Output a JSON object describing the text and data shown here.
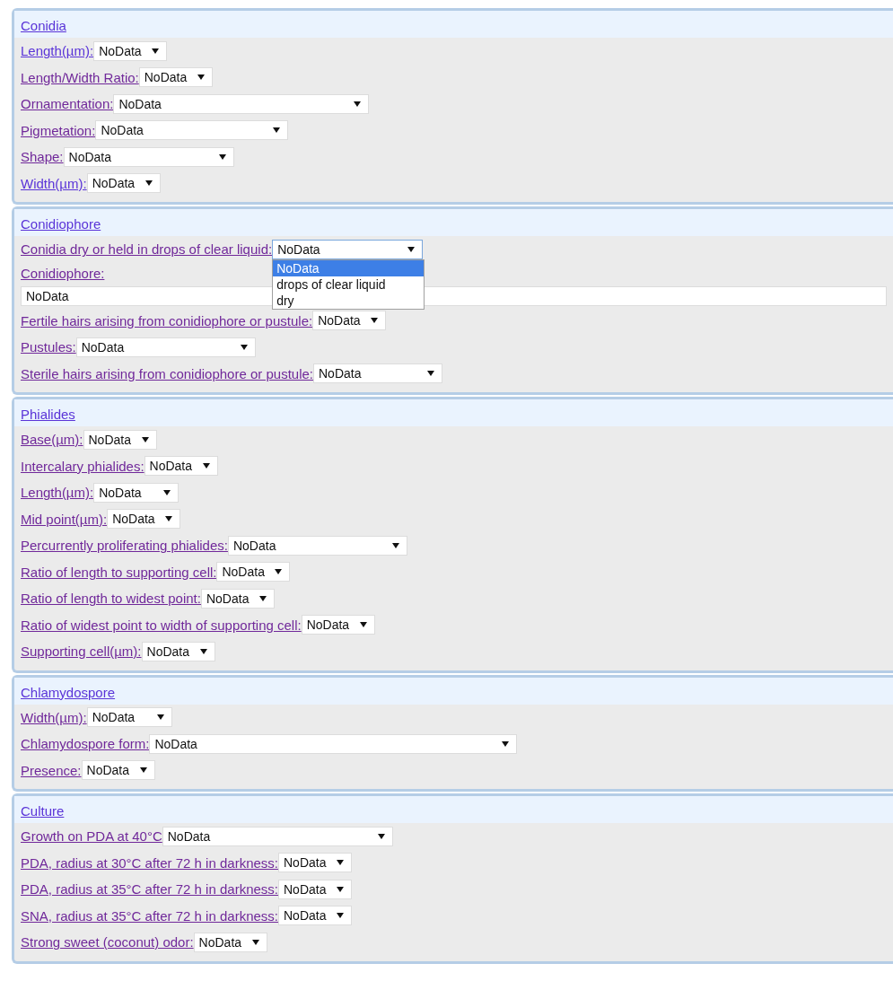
{
  "sections": [
    {
      "title": "Conidia",
      "fields": [
        {
          "kind": "select",
          "label": "Length(µm):",
          "visited": false,
          "value": "NoData",
          "open": false
        },
        {
          "kind": "select",
          "label": "Length/Width Ratio:",
          "visited": true,
          "value": "NoData",
          "open": false
        },
        {
          "kind": "select",
          "label": "Ornamentation:",
          "visited": true,
          "value": "NoData",
          "open": false
        },
        {
          "kind": "select",
          "label": "Pigmetation:",
          "visited": true,
          "value": "NoData",
          "open": false
        },
        {
          "kind": "select",
          "label": "Shape:",
          "visited": true,
          "value": "NoData",
          "open": false
        },
        {
          "kind": "select",
          "label": "Width(µm):",
          "visited": false,
          "value": "NoData",
          "open": false
        }
      ]
    },
    {
      "title": "Conidiophore",
      "fields": [
        {
          "kind": "select",
          "label": "Conidia dry or held in drops of clear liquid:",
          "visited": true,
          "value": "NoData",
          "open": true,
          "options": [
            {
              "label": "NoData",
              "selected": true
            },
            {
              "label": "drops of clear liquid",
              "selected": false
            },
            {
              "label": "dry",
              "selected": false
            }
          ]
        },
        {
          "kind": "text",
          "label": "Conidiophore:",
          "visited": true,
          "value": "NoData"
        },
        {
          "kind": "select",
          "label": "Fertile hairs arising from conidiophore or pustule:",
          "visited": true,
          "value": "NoData",
          "open": false
        },
        {
          "kind": "select",
          "label": "Pustules:",
          "visited": true,
          "value": "NoData",
          "open": false
        },
        {
          "kind": "select",
          "label": "Sterile hairs arising from conidiophore or pustule:",
          "visited": true,
          "value": "NoData",
          "open": false
        }
      ]
    },
    {
      "title": "Phialides",
      "fields": [
        {
          "kind": "select",
          "label": "Base(µm):",
          "visited": true,
          "value": "NoData",
          "open": false
        },
        {
          "kind": "select",
          "label": "Intercalary phialides:",
          "visited": true,
          "value": "NoData",
          "open": false
        },
        {
          "kind": "select",
          "label": "Length(µm):",
          "visited": true,
          "value": "NoData",
          "open": false
        },
        {
          "kind": "select",
          "label": "Mid point(µm):",
          "visited": true,
          "value": "NoData",
          "open": false
        },
        {
          "kind": "select",
          "label": "Percurrently proliferating phialides:",
          "visited": true,
          "value": "NoData",
          "open": false
        },
        {
          "kind": "select",
          "label": "Ratio of length to supporting cell:",
          "visited": true,
          "value": "NoData",
          "open": false
        },
        {
          "kind": "select",
          "label": "Ratio of length to widest point:",
          "visited": true,
          "value": "NoData",
          "open": false
        },
        {
          "kind": "select",
          "label": "Ratio of widest point to width of supporting cell:",
          "visited": true,
          "value": "NoData",
          "open": false
        },
        {
          "kind": "select",
          "label": "Supporting cell(µm):",
          "visited": true,
          "value": "NoData",
          "open": false
        }
      ]
    },
    {
      "title": "Chlamydospore",
      "fields": [
        {
          "kind": "select",
          "label": "Width(µm):",
          "visited": true,
          "value": "NoData",
          "open": false
        },
        {
          "kind": "select",
          "label": "Chlamydospore form:",
          "visited": true,
          "value": "NoData",
          "open": false
        },
        {
          "kind": "select",
          "label": "Presence:",
          "visited": true,
          "value": "NoData",
          "open": false
        }
      ]
    },
    {
      "title": "Culture",
      "fields": [
        {
          "kind": "select",
          "label": "Growth on PDA at 40°C",
          "visited": true,
          "value": "NoData",
          "open": false
        },
        {
          "kind": "select",
          "label": "PDA, radius at 30°C after 72 h in darkness:",
          "visited": true,
          "value": "NoData",
          "open": false
        },
        {
          "kind": "select",
          "label": "PDA, radius at 35°C after 72 h in darkness:",
          "visited": true,
          "value": "NoData",
          "open": false
        },
        {
          "kind": "select",
          "label": "SNA, radius at 35°C after 72 h in darkness:",
          "visited": true,
          "value": "NoData",
          "open": false
        },
        {
          "kind": "select",
          "label": "Strong sweet (coconut) odor:",
          "visited": true,
          "value": "NoData",
          "open": false
        }
      ]
    }
  ]
}
